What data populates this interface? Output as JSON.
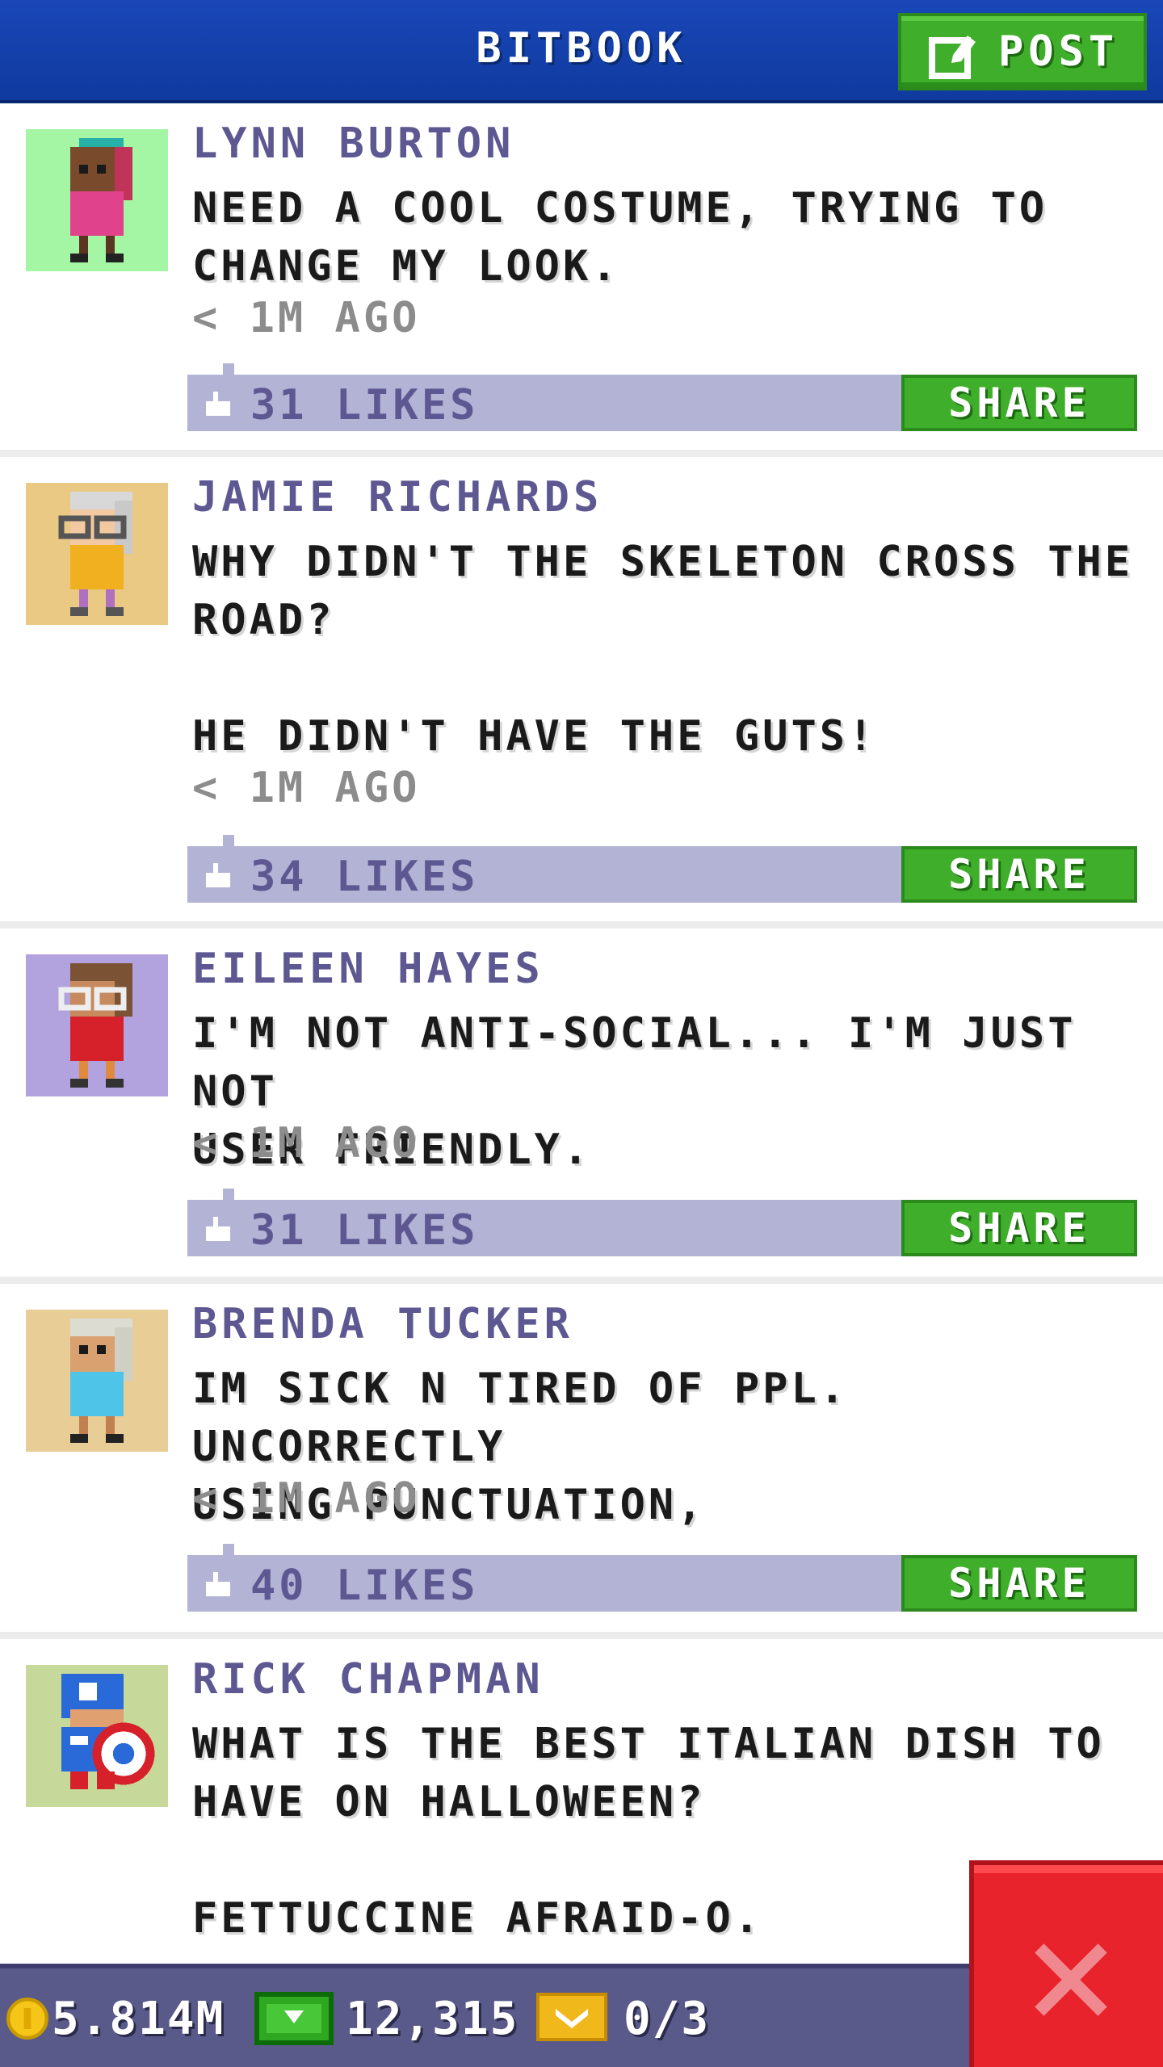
{
  "header": {
    "title": "BITBOOK",
    "post_label": "POST"
  },
  "posts": [
    {
      "name": "LYNN BURTON",
      "text": "NEED A COOL COSTUME, TRYING TO\nCHANGE MY LOOK.",
      "time": "< 1M AGO",
      "likes": "31 LIKES",
      "share_label": "SHARE",
      "avatar_bg": "#a4f5a4"
    },
    {
      "name": "JAMIE RICHARDS",
      "text": "WHY DIDN'T THE SKELETON CROSS THE\nROAD?\n\nHE DIDN'T HAVE THE GUTS!",
      "time": "< 1M AGO",
      "likes": "34 LIKES",
      "share_label": "SHARE",
      "avatar_bg": "#eac985"
    },
    {
      "name": "EILEEN HAYES",
      "text": "I'M NOT ANTI-SOCIAL... I'M JUST NOT\nUSER FRIENDLY.",
      "time": "< 1M AGO",
      "likes": "31 LIKES",
      "share_label": "SHARE",
      "avatar_bg": "#b2a3de"
    },
    {
      "name": "BRENDA TUCKER",
      "text": "IM SICK N TIRED OF PPL. UNCORRECTLY\nUSING PUNCTUATION,",
      "time": "< 1M AGO",
      "likes": "40 LIKES",
      "share_label": "SHARE",
      "avatar_bg": "#e9cd96"
    },
    {
      "name": "RICK CHAPMAN",
      "text": "WHAT IS THE BEST ITALIAN DISH TO\nHAVE ON HALLOWEEN?\n\nFETTUCCINE AFRAID-O.",
      "avatar_bg": "#c6d99a"
    }
  ],
  "footer": {
    "coins": "5.814M",
    "bux": "12,315",
    "tickets": "0/3"
  },
  "colors": {
    "header_blue": "#1a47b8",
    "accent_green": "#3fae2a",
    "like_bar": "#b3b3d6",
    "name_purple": "#5d5891",
    "close_red": "#e8232b",
    "footer": "#5a5a8a"
  },
  "icons": {
    "post": "edit-icon",
    "like": "thumbs-up-icon",
    "coin": "coin-icon",
    "bux": "bux-icon",
    "ticket": "ticket-icon",
    "close": "close-icon"
  }
}
